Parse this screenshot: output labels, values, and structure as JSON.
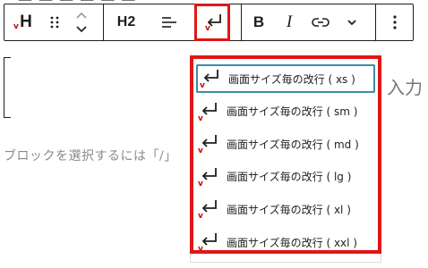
{
  "toolbar": {
    "heading_icon_label": "H",
    "heading_level_label": "H2",
    "bold_label": "B",
    "italic_label": "I"
  },
  "editor": {
    "right_partial_text": "入力",
    "placeholder": "ブロックを選択するには「/」"
  },
  "dropdown": {
    "items": [
      {
        "label": "画面サイズ毎の改行 ( xs )",
        "active": true
      },
      {
        "label": "画面サイズ毎の改行 ( sm )",
        "active": false
      },
      {
        "label": "画面サイズ毎の改行 ( md )",
        "active": false
      },
      {
        "label": "画面サイズ毎の改行 ( lg )",
        "active": false
      },
      {
        "label": "画面サイズ毎の改行 ( xl )",
        "active": false
      },
      {
        "label": "画面サイズ毎の改行 ( xxl )",
        "active": false
      }
    ]
  },
  "colors": {
    "highlight_red": "#e01616",
    "focus_blue": "#3c8ca8",
    "border_dark": "#1e1e1e"
  }
}
